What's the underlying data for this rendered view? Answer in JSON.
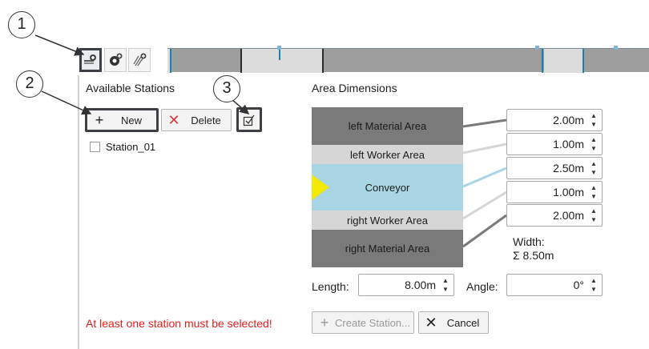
{
  "callouts": [
    "1",
    "2",
    "3"
  ],
  "toolbar": {
    "icons": [
      "station-layout-icon",
      "station-add-icon",
      "area-hatch-icon"
    ]
  },
  "stations_panel": {
    "title": "Available Stations",
    "new_label": "New",
    "delete_label": "Delete",
    "edit_icon": "edit-checkbox-icon",
    "items": [
      {
        "label": "Station_01",
        "checked": false
      }
    ],
    "error": "At least one station must be selected!"
  },
  "dimensions": {
    "title": "Area Dimensions",
    "areas": [
      {
        "label": "left Material Area",
        "value": "2.00m"
      },
      {
        "label": "left Worker Area",
        "value": "1.00m"
      },
      {
        "label": "Conveyor",
        "value": "2.50m"
      },
      {
        "label": "right Worker Area",
        "value": "1.00m"
      },
      {
        "label": "right Material Area",
        "value": "2.00m"
      }
    ],
    "width_label": "Width:",
    "width_total": "Σ 8.50m",
    "length_label": "Length:",
    "length_value": "8.00m",
    "angle_label": "Angle:",
    "angle_value": "0°",
    "colors": {
      "material": "#7a7a7a",
      "worker": "#d6d6d6",
      "conveyor": "#a8d6e4",
      "arrow": "#f2ea00"
    }
  },
  "actions": {
    "create_label": "Create Station...",
    "cancel_label": "Cancel"
  }
}
